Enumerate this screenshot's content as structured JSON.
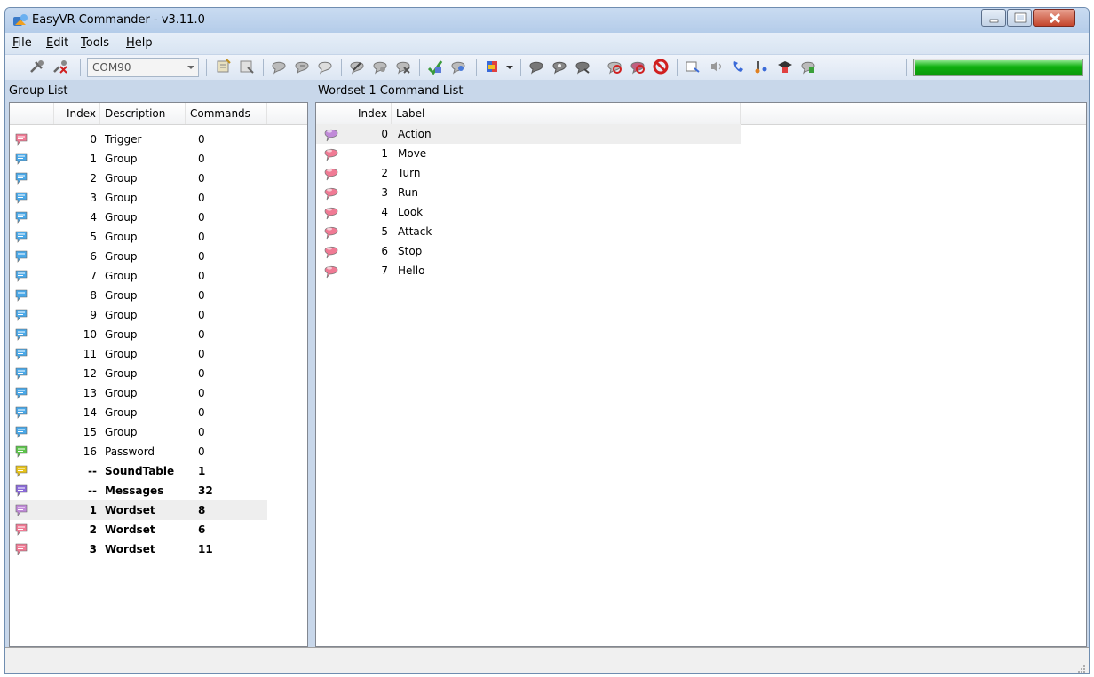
{
  "window": {
    "title": "EasyVR Commander - v3.11.0"
  },
  "menu": [
    {
      "label": "File",
      "accel": "F",
      "rest": "ile"
    },
    {
      "label": "Edit",
      "accel": "E",
      "rest": "dit"
    },
    {
      "label": "Tools",
      "accel": "T",
      "rest": "ools"
    },
    {
      "label": "Help",
      "accel": "H",
      "rest": "elp"
    }
  ],
  "toolbar": {
    "port_value": "COM90",
    "progress_fraction": 1.0
  },
  "group_list": {
    "title": "Group List",
    "columns": {
      "index": "Index",
      "description": "Description",
      "commands": "Commands"
    },
    "rows": [
      {
        "index": "0",
        "description": "Trigger",
        "commands": "0",
        "bold": false,
        "icon": "speech-bubble-icon-pink"
      },
      {
        "index": "1",
        "description": "Group",
        "commands": "0",
        "bold": false,
        "icon": "speech-bubble-icon-blue"
      },
      {
        "index": "2",
        "description": "Group",
        "commands": "0",
        "bold": false,
        "icon": "speech-bubble-icon-blue"
      },
      {
        "index": "3",
        "description": "Group",
        "commands": "0",
        "bold": false,
        "icon": "speech-bubble-icon-blue"
      },
      {
        "index": "4",
        "description": "Group",
        "commands": "0",
        "bold": false,
        "icon": "speech-bubble-icon-blue"
      },
      {
        "index": "5",
        "description": "Group",
        "commands": "0",
        "bold": false,
        "icon": "speech-bubble-icon-blue"
      },
      {
        "index": "6",
        "description": "Group",
        "commands": "0",
        "bold": false,
        "icon": "speech-bubble-icon-blue"
      },
      {
        "index": "7",
        "description": "Group",
        "commands": "0",
        "bold": false,
        "icon": "speech-bubble-icon-blue"
      },
      {
        "index": "8",
        "description": "Group",
        "commands": "0",
        "bold": false,
        "icon": "speech-bubble-icon-blue"
      },
      {
        "index": "9",
        "description": "Group",
        "commands": "0",
        "bold": false,
        "icon": "speech-bubble-icon-blue"
      },
      {
        "index": "10",
        "description": "Group",
        "commands": "0",
        "bold": false,
        "icon": "speech-bubble-icon-blue"
      },
      {
        "index": "11",
        "description": "Group",
        "commands": "0",
        "bold": false,
        "icon": "speech-bubble-icon-blue"
      },
      {
        "index": "12",
        "description": "Group",
        "commands": "0",
        "bold": false,
        "icon": "speech-bubble-icon-blue"
      },
      {
        "index": "13",
        "description": "Group",
        "commands": "0",
        "bold": false,
        "icon": "speech-bubble-icon-blue"
      },
      {
        "index": "14",
        "description": "Group",
        "commands": "0",
        "bold": false,
        "icon": "speech-bubble-icon-blue"
      },
      {
        "index": "15",
        "description": "Group",
        "commands": "0",
        "bold": false,
        "icon": "speech-bubble-icon-blue"
      },
      {
        "index": "16",
        "description": "Password",
        "commands": "0",
        "bold": false,
        "icon": "speech-bubble-icon-green"
      },
      {
        "index": "--",
        "description": "SoundTable",
        "commands": "1",
        "bold": true,
        "icon": "speech-bubble-icon-yellow"
      },
      {
        "index": "--",
        "description": "Messages",
        "commands": "32",
        "bold": true,
        "icon": "speech-bubble-icon-purple"
      },
      {
        "index": "1",
        "description": "Wordset",
        "commands": "8",
        "bold": true,
        "icon": "speech-bubble-icon-lilac",
        "selected": true
      },
      {
        "index": "2",
        "description": "Wordset",
        "commands": "6",
        "bold": true,
        "icon": "speech-bubble-icon-pink"
      },
      {
        "index": "3",
        "description": "Wordset",
        "commands": "11",
        "bold": true,
        "icon": "speech-bubble-icon-pink"
      }
    ]
  },
  "command_list": {
    "title": "Wordset 1 Command List",
    "columns": {
      "index": "Index",
      "label": "Label"
    },
    "rows": [
      {
        "index": "0",
        "label": "Action",
        "selected": true
      },
      {
        "index": "1",
        "label": "Move"
      },
      {
        "index": "2",
        "label": "Turn"
      },
      {
        "index": "3",
        "label": "Run"
      },
      {
        "index": "4",
        "label": "Look"
      },
      {
        "index": "5",
        "label": "Attack"
      },
      {
        "index": "6",
        "label": "Stop"
      },
      {
        "index": "7",
        "label": "Hello"
      }
    ]
  },
  "colors": {
    "blue": "#4aa8e8",
    "pink": "#f07a94",
    "green": "#5cc44a",
    "yellow": "#e6c21a",
    "purple": "#8a6ad8",
    "lilac": "#c08ad8",
    "progress": "#10b010"
  },
  "toolbar_icons": [
    "connect-icon",
    "disconnect-icon",
    "add-group-icon",
    "remove-group-icon",
    "add-command-icon",
    "insert-command-icon",
    "remove-command-icon",
    "edit-command-icon",
    "train-command-icon",
    "erase-training-icon",
    "test-group-icon",
    "verify-icon",
    "color-tool-icon",
    "dropdown-icon",
    "speak-icon",
    "recognize-icon",
    "speaker-icon",
    "stop-icon",
    "no-sign-icon",
    "record-icon",
    "play-icon",
    "phone-icon",
    "sound-icon",
    "firmware-icon",
    "help-icon"
  ]
}
